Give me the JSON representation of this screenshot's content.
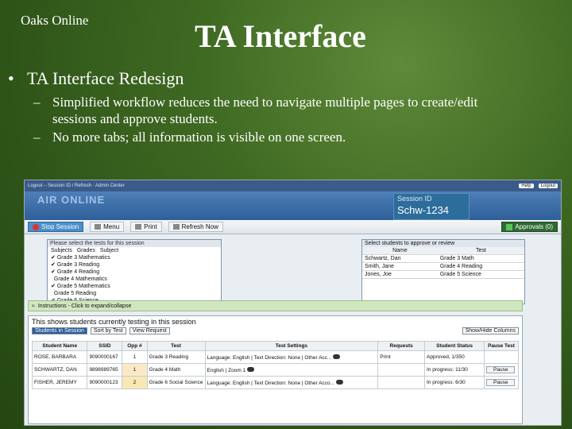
{
  "slide": {
    "brand": "Oaks Online",
    "title": "TA Interface",
    "bullet1": "TA Interface Redesign",
    "sub1_line1": "Simplified workflow reduces the need to navigate multiple pages to create/edit",
    "sub1_line2": "sessions and approve students.",
    "sub2": "No more tabs; all information is visible on one screen."
  },
  "browser": {
    "crumbs": "Logout – Session ID / Refresh · Admin Center",
    "help": "Help",
    "logout": "Logout"
  },
  "banner": {
    "logo": "AIR ONLINE",
    "session_label": "Session ID",
    "session_id": "Schw-1234"
  },
  "toolbar": {
    "stop": "Stop Session",
    "menu": "Menu",
    "print": "Print",
    "refresh": "Refresh Now",
    "approvals": "Approvals (0)"
  },
  "tests_panel": {
    "header": "Please select the tests for this session",
    "filter_prefix": "Subjects",
    "filter_grades": "Grades",
    "filter_subject": "Subject",
    "items": [
      "Grade 3 Mathematics",
      "Grade 3 Reading",
      "Grade 4 Reading",
      "Grade 4 Mathematics",
      "Grade 5 Mathematics",
      "Grade 5 Reading",
      "Grade 6 Science"
    ]
  },
  "approval_panel": {
    "header": "Select students to approve or review",
    "col_name": "Name",
    "col_test": "Test",
    "rows": [
      {
        "name": "Schwartz, Dan",
        "test": "Grade 3 Math"
      },
      {
        "name": "Smith, Jane",
        "test": "Grade 4 Reading"
      },
      {
        "name": "Jones, Joe",
        "test": "Grade 5 Science"
      }
    ]
  },
  "instructions": "Instructions - Click to expand/collapse",
  "students": {
    "caption": "This shows students currently testing in this session",
    "view_select": "Students in Session",
    "sort_select": "Sort by Test",
    "new_request": "View Request",
    "columns_select": "Show/Hide Columns",
    "headers": [
      "Student Name",
      "SSID",
      "Opp #",
      "Test",
      "Test Settings",
      "Requests",
      "Student Status",
      "Pause Test"
    ],
    "rows": [
      {
        "name": "ROSE, BARBARA",
        "ssid": "9090000167",
        "opp": "1",
        "test": "Grade 3 Reading",
        "settings": "Language: English | Text Direction: None | Other Acc...",
        "request": "Print",
        "status": "Approved, 1/350",
        "pause": ""
      },
      {
        "name": "SCHWARTZ, DAN",
        "ssid": "9898989765",
        "opp": "1",
        "test": "Grade 4 Math",
        "settings": "English | Zoom 1",
        "request": "",
        "status": "In progress: 11/30",
        "pause": "Pause"
      },
      {
        "name": "FISHER, JEREMY",
        "ssid": "9090000123",
        "opp": "2",
        "test": "Grade 6 Social Science",
        "settings": "Language: English | Text Direction: None | Other Acco...",
        "request": "",
        "status": "In progress: 6/30",
        "pause": "Pause"
      }
    ]
  }
}
